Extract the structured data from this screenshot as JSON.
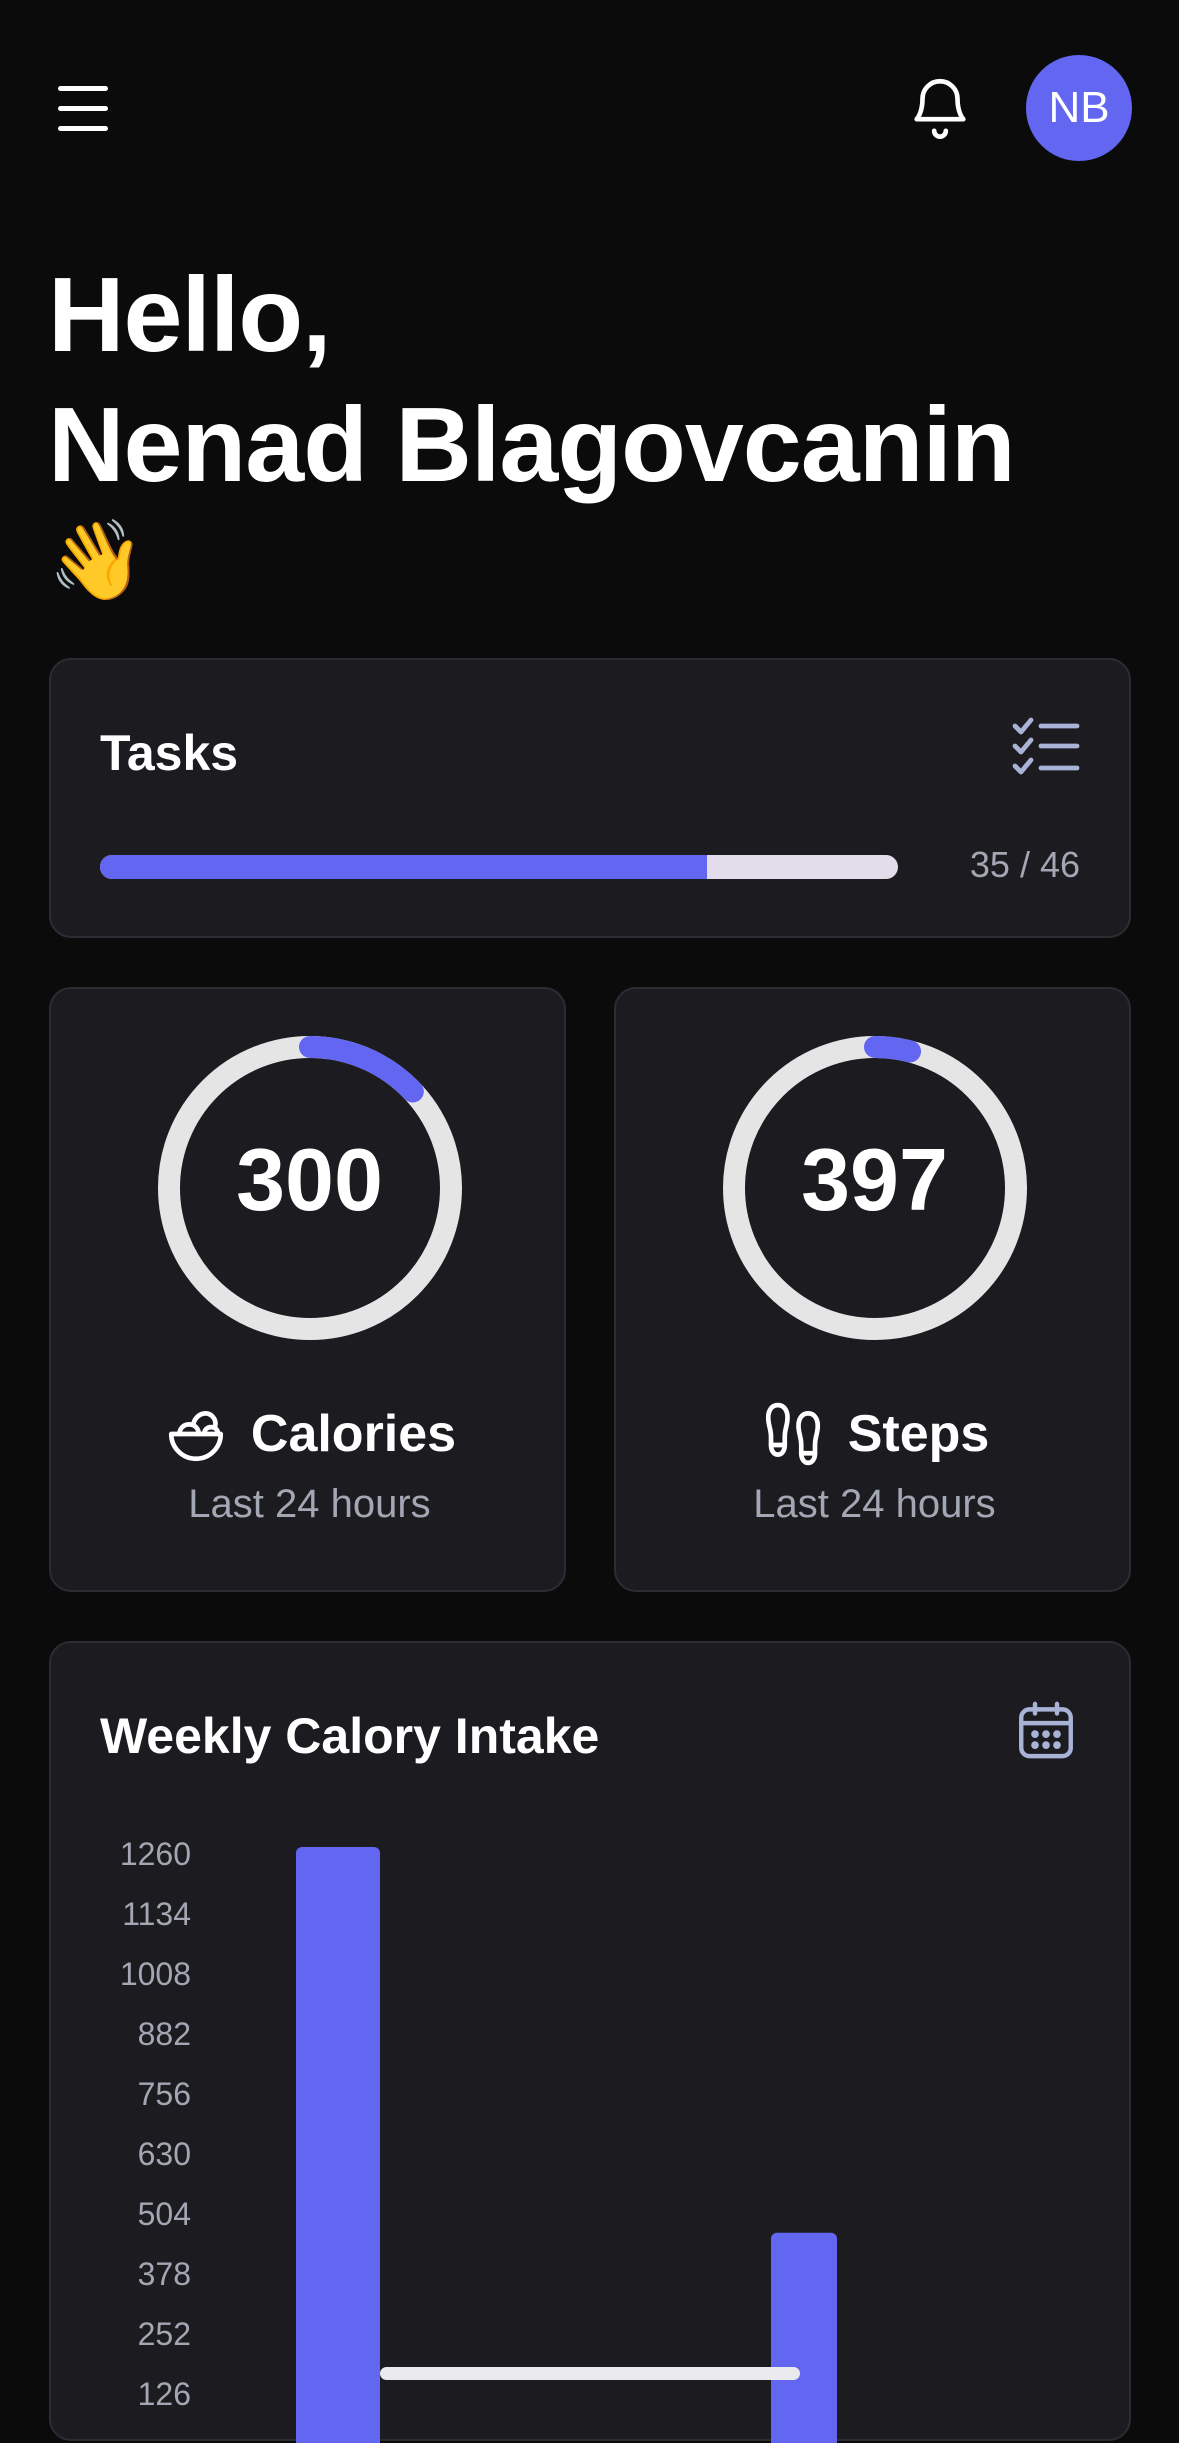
{
  "header": {
    "menu_icon": "hamburger-menu-icon",
    "notification_icon": "bell-icon",
    "avatar_initials": "NB",
    "avatar_color": "#6366f1"
  },
  "greeting": {
    "line1": "Hello,",
    "line2": "Nenad Blagovcanin",
    "emoji": "👋"
  },
  "tasks": {
    "title": "Tasks",
    "icon": "checklist-icon",
    "completed": 35,
    "total": 46,
    "count_text": "35 / 46"
  },
  "stats": [
    {
      "value": "300",
      "label": "Calories",
      "sublabel": "Last 24 hours",
      "icon": "salad-bowl-icon",
      "progress": 0.13
    },
    {
      "value": "397",
      "label": "Steps",
      "sublabel": "Last 24 hours",
      "icon": "footprints-icon",
      "progress": 0.04
    }
  ],
  "weekly": {
    "title": "Weekly Calory Intake",
    "icon": "calendar-icon"
  },
  "colors": {
    "accent": "#6366f1",
    "background": "#0b0b0c",
    "card": "#1b1b20",
    "muted_text": "#a3a6b3",
    "track": "#e3dcea"
  },
  "chart_data": {
    "type": "bar",
    "yticks": [
      126,
      252,
      378,
      504,
      630,
      756,
      882,
      1008,
      1134,
      1260
    ],
    "ylim": [
      0,
      1260
    ],
    "bars": [
      {
        "slot": 1,
        "value": 1260
      },
      {
        "slot": 6,
        "value": 450
      }
    ]
  }
}
